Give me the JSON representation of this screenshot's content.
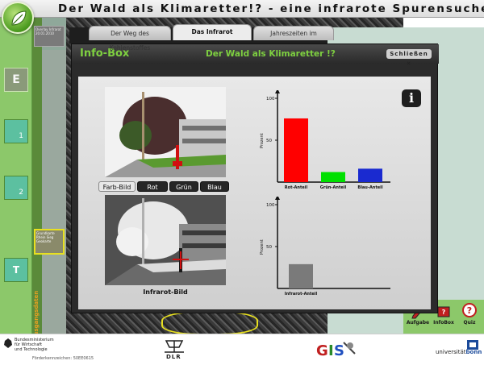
{
  "header": {
    "title": "Der Wald als Klimaretter!? - eine infrarote Spurensuche"
  },
  "sidebar": {
    "items": [
      {
        "label": "E",
        "num": ""
      },
      {
        "label": "",
        "num": "1"
      },
      {
        "label": "",
        "num": "2"
      },
      {
        "label": "T",
        "num": ""
      }
    ]
  },
  "layer_strip": {
    "top_label": "Overlay Infrarot",
    "date": "20.01.2010",
    "mid_label": "Grundkarte Rhein Sieg",
    "mid_sub": "Geokarte",
    "vertical_label": "Ausgangsdaten"
  },
  "infobox": {
    "title": "Info-Box",
    "subtitle": "Der Wald als Klimaretter !?",
    "close_label": "Schließen",
    "tabs": [
      {
        "label": "Der Weg des Kohlenstoffes",
        "active": false
      },
      {
        "label": "Das Infrarot",
        "active": true
      },
      {
        "label": "Jahreszeiten im",
        "active": false
      }
    ],
    "color_buttons": [
      "Farb-Bild",
      "Rot",
      "Grün",
      "Blau"
    ],
    "ir_caption": "Infrarot-Bild"
  },
  "tools": [
    {
      "label": "Aufgabe"
    },
    {
      "label": "InfoBox"
    },
    {
      "label": "Quiz"
    }
  ],
  "footer": {
    "bmwi": [
      "Bundesministerium",
      "für Wirtschaft",
      "und Technologie"
    ],
    "foerder": "Förderkennzeichen: 50EE0615",
    "dlr": "DLR",
    "gis": "GIS",
    "bonn_pre": "universität",
    "bonn_post": "bonn"
  },
  "chart_data": [
    {
      "type": "bar",
      "categories": [
        "Rot-Anteil",
        "Grün-Anteil",
        "Blau-Anteil"
      ],
      "values": [
        76,
        12,
        16
      ],
      "colors": [
        "#ff0000",
        "#00e000",
        "#1a2ad0"
      ],
      "ylabel": "Prozent",
      "ylim": [
        0,
        100
      ],
      "yticks": [
        0,
        50,
        100
      ]
    },
    {
      "type": "bar",
      "categories": [
        "Infrarot-Anteil"
      ],
      "values": [
        29
      ],
      "colors": [
        "#7a7a7a"
      ],
      "ylabel": "Prozent",
      "ylim": [
        0,
        100
      ],
      "yticks": [
        0,
        50,
        100
      ]
    }
  ]
}
